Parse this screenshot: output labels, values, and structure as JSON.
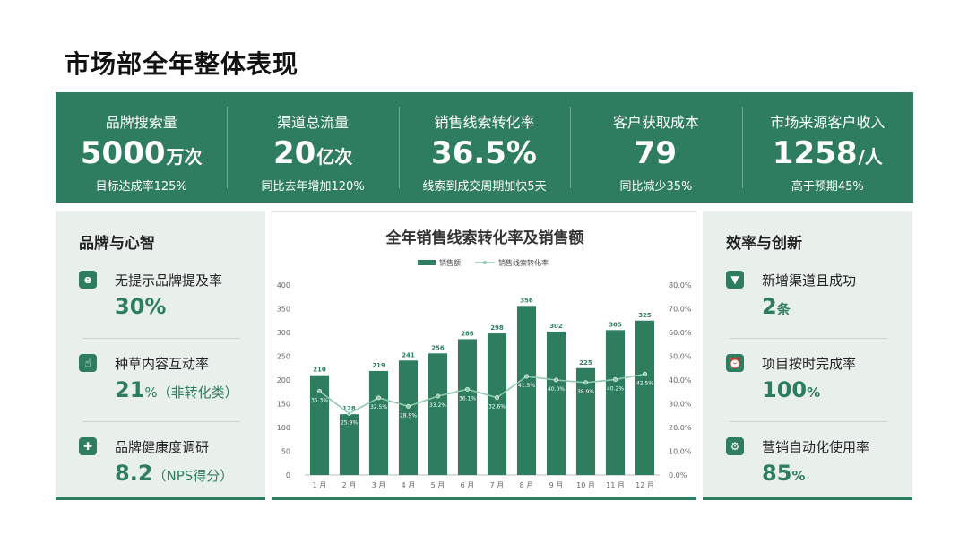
{
  "page": {
    "title": "市场部全年整体表现"
  },
  "kpis": [
    {
      "label": "品牌搜索量",
      "value": "5000",
      "unit": "万次",
      "sub": "目标达成率125%"
    },
    {
      "label": "渠道总流量",
      "value": "20",
      "unit": "亿次",
      "sub": "同比去年增加120%"
    },
    {
      "label": "销售线索转化率",
      "value": "36.5%",
      "unit": "",
      "sub": "线索到成交周期加快5天"
    },
    {
      "label": "客户获取成本",
      "value": "79",
      "unit": "",
      "sub": "同比减少35%"
    },
    {
      "label": "市场来源客户收入",
      "value": "1258",
      "unit": "/人",
      "sub": "高于预期45%"
    }
  ],
  "left_card": {
    "title": "品牌与心智",
    "metrics": [
      {
        "icon": "browser-icon",
        "label": "无提示品牌提及率",
        "value": "30%",
        "unit": ""
      },
      {
        "icon": "hand-tap-icon",
        "label": "种草内容互动率",
        "value": "21",
        "unit": "%（非转化类）"
      },
      {
        "icon": "survey-icon",
        "label": "品牌健康度调研",
        "value": "8.2",
        "unit": "（NPS得分）"
      }
    ]
  },
  "right_card": {
    "title": "效率与创新",
    "metrics": [
      {
        "icon": "funnel-icon",
        "label": "新增渠道且成功",
        "value": "2",
        "unit": "条"
      },
      {
        "icon": "alarm-clock-icon",
        "label": "项目按时完成率",
        "value": "100",
        "unit": "%"
      },
      {
        "icon": "gear-icon",
        "label": "营销自动化使用率",
        "value": "85",
        "unit": "%"
      }
    ]
  },
  "colors": {
    "accent": "#2e7d5e",
    "line": "#8ec9ae",
    "card_bg": "#e9f0ec"
  },
  "chart_data": {
    "type": "bar",
    "title": "全年销售线索转化率及销售额",
    "categories": [
      "1 月",
      "2 月",
      "3 月",
      "4 月",
      "5 月",
      "6 月",
      "7 月",
      "8 月",
      "9 月",
      "10 月",
      "11 月",
      "12 月"
    ],
    "series": [
      {
        "name": "销售额",
        "type": "bar",
        "axis": "left",
        "values": [
          210,
          128,
          219,
          241,
          256,
          286,
          298,
          356,
          302,
          225,
          305,
          325
        ],
        "labels": [
          "210",
          "128",
          "219",
          "241",
          "256",
          "286",
          "298",
          "356",
          "302",
          "225",
          "305",
          "325"
        ]
      },
      {
        "name": "销售线索转化率",
        "type": "line",
        "axis": "right",
        "values": [
          35.3,
          25.9,
          32.5,
          28.9,
          33.2,
          36.1,
          32.6,
          41.5,
          40.0,
          38.9,
          40.2,
          42.5
        ],
        "labels": [
          "35.3%",
          "25.9%",
          "32.5%",
          "28.9%",
          "33.2%",
          "36.1%",
          "32.6%",
          "41.5%",
          "40.0%",
          "38.9%",
          "40.2%",
          "42.5%"
        ]
      }
    ],
    "ylim": [
      0,
      400
    ],
    "y_ticks": [
      "0",
      "50",
      "100",
      "150",
      "200",
      "250",
      "300",
      "350",
      "400"
    ],
    "y2lim": [
      0,
      80
    ],
    "y2_ticks": [
      "0.0%",
      "10.0%",
      "20.0%",
      "30.0%",
      "40.0%",
      "50.0%",
      "60.0%",
      "70.0%",
      "80.0%"
    ],
    "legend_position": "top",
    "grid": false
  }
}
